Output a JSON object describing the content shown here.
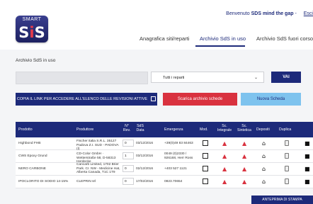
{
  "logo": {
    "top": "SMART",
    "main_a": "S",
    "main_b": "i",
    "main_c": "S"
  },
  "header": {
    "welcome_prefix": "Benvenuto",
    "user": "SDS mind the gap",
    "separator": "-",
    "exit": "Esci"
  },
  "nav": [
    {
      "label": "Anagrafica siti/reparti"
    },
    {
      "label": "Archivio SdS in uso"
    },
    {
      "label": "Archivio SdS fuori corso"
    }
  ],
  "section_title": "Archivio SdS in uso",
  "filter": {
    "search_value": "",
    "select_value": "Tutti i reparti",
    "go_label": "VAI"
  },
  "actions": {
    "copy_label": "COPIA IL LINK PER ACCEDERE ALL'ELENCO DELLE REVISIONI ATTIVE",
    "download_label": "Scarica archivio schede",
    "new_label": "Nuova Scheda"
  },
  "table": {
    "headers": {
      "prodotto": "Prodotto",
      "produttore": "Produttore",
      "rev": "N° Rev.",
      "data": "SdS Data",
      "emergenza": "Emergenza",
      "mod": "Mod.",
      "integrale": "Sc. Integrale",
      "sintetica": "Sc. Sintetica",
      "depositi": "Depositi",
      "duplica": "Duplica"
    },
    "rows": [
      {
        "prodotto": "Highbond FHB",
        "produttore": "Fischer italia S.R.L. 35127 Padova Z.I. SUD - PADOVA (I)",
        "rev": "0",
        "data": "03/12/2016",
        "emergenza": "+39(0)49 83 84463"
      },
      {
        "prodotto": "CWS Epoxy Grund",
        "produttore": "CD-Color GmbH · Wetterstraße 58, D-58313 Herdecke",
        "rev": "1",
        "data": "03/12/2016",
        "emergenza": "0049 (0)2330 / 926168, Herr Ross"
      },
      {
        "prodotto": "NERO CARBONE",
        "produttore": "Cancarb Limited, 1702 Brier Park. Cr. NW - Medicine Hat, Alberta Canada, T1C 1T9",
        "rev": "0",
        "data": "02/12/2016",
        "emergenza": "+403 527 1121"
      },
      {
        "prodotto": "IPOCLORITO DI SODIO 14-15%",
        "produttore": "CLEPRIN srl",
        "rev": "0",
        "data": "17/02/2016",
        "emergenza": "0823.70654"
      }
    ]
  },
  "preview_label": "ANTEPRIMA DI STAMPA",
  "colors": {
    "primary": "#1d2a7a",
    "danger": "#d9323f",
    "info": "#7ec3ee"
  }
}
